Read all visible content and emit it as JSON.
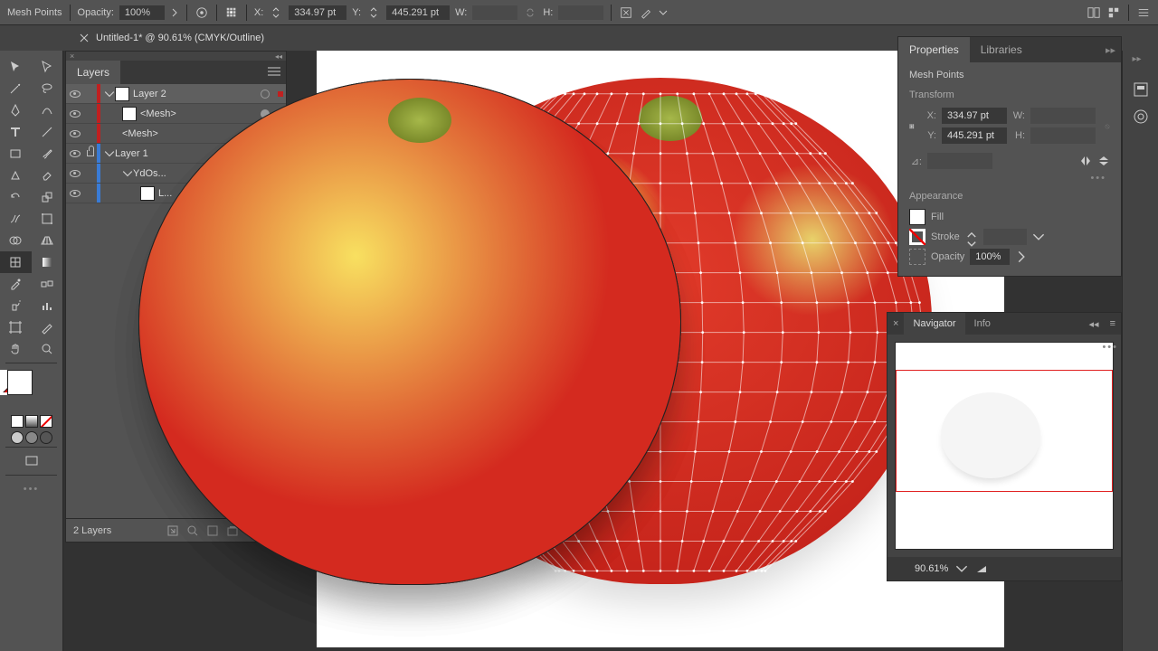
{
  "control_bar": {
    "selection_label": "Mesh Points",
    "opacity_label": "Opacity:",
    "opacity_value": "100%",
    "x_label": "X:",
    "x_value": "334.97 pt",
    "y_label": "Y:",
    "y_value": "445.291 pt",
    "w_label": "W:",
    "w_value": "",
    "h_label": "H:",
    "h_value": ""
  },
  "document": {
    "tab_title": "Untitled-1* @ 90.61% (CMYK/Outline)"
  },
  "layers": {
    "panel_title": "Layers",
    "count_label": "2 Layers",
    "rows": [
      {
        "name": "Layer 2",
        "thumb": "white",
        "depth": 0,
        "color": "red",
        "expanded": true,
        "vis": true,
        "lock": false,
        "selmark": "dot",
        "target": "circle",
        "selected": true
      },
      {
        "name": "<Mesh>",
        "thumb": "white",
        "depth": 1,
        "color": "red",
        "expanded": false,
        "vis": true,
        "lock": false,
        "selmark": "dot",
        "target": "fill",
        "selected": false
      },
      {
        "name": "<Mesh>",
        "thumb": "apple",
        "depth": 1,
        "color": "red",
        "expanded": false,
        "vis": true,
        "lock": false,
        "selmark": "",
        "target": "circle",
        "selected": false
      },
      {
        "name": "Layer 1",
        "thumb": "apple",
        "depth": 0,
        "color": "blue",
        "expanded": true,
        "vis": true,
        "lock": true,
        "selmark": "",
        "target": "circle",
        "selected": false
      },
      {
        "name": "YdOs...",
        "thumb": "apple",
        "depth": 1,
        "color": "blue",
        "expanded": true,
        "vis": true,
        "lock": false,
        "selmark": "",
        "target": "circle",
        "selected": false
      },
      {
        "name": "L...",
        "thumb": "white",
        "depth": 2,
        "color": "blue",
        "expanded": false,
        "vis": true,
        "lock": false,
        "selmark": "",
        "target": "circle",
        "selected": false
      }
    ]
  },
  "properties": {
    "tabs": {
      "properties": "Properties",
      "libraries": "Libraries"
    },
    "selection_type": "Mesh Points",
    "transform": {
      "title": "Transform",
      "x_label": "X:",
      "x_value": "334.97 pt",
      "y_label": "Y:",
      "y_value": "445.291 pt",
      "w_label": "W:",
      "w_value": "",
      "h_label": "H:",
      "h_value": "",
      "angle_label": "⊿:"
    },
    "appearance": {
      "title": "Appearance",
      "fill_label": "Fill",
      "stroke_label": "Stroke",
      "opacity_label": "Opacity",
      "opacity_value": "100%"
    }
  },
  "navigator": {
    "tabs": {
      "nav": "Navigator",
      "info": "Info"
    },
    "zoom": "90.61%"
  }
}
